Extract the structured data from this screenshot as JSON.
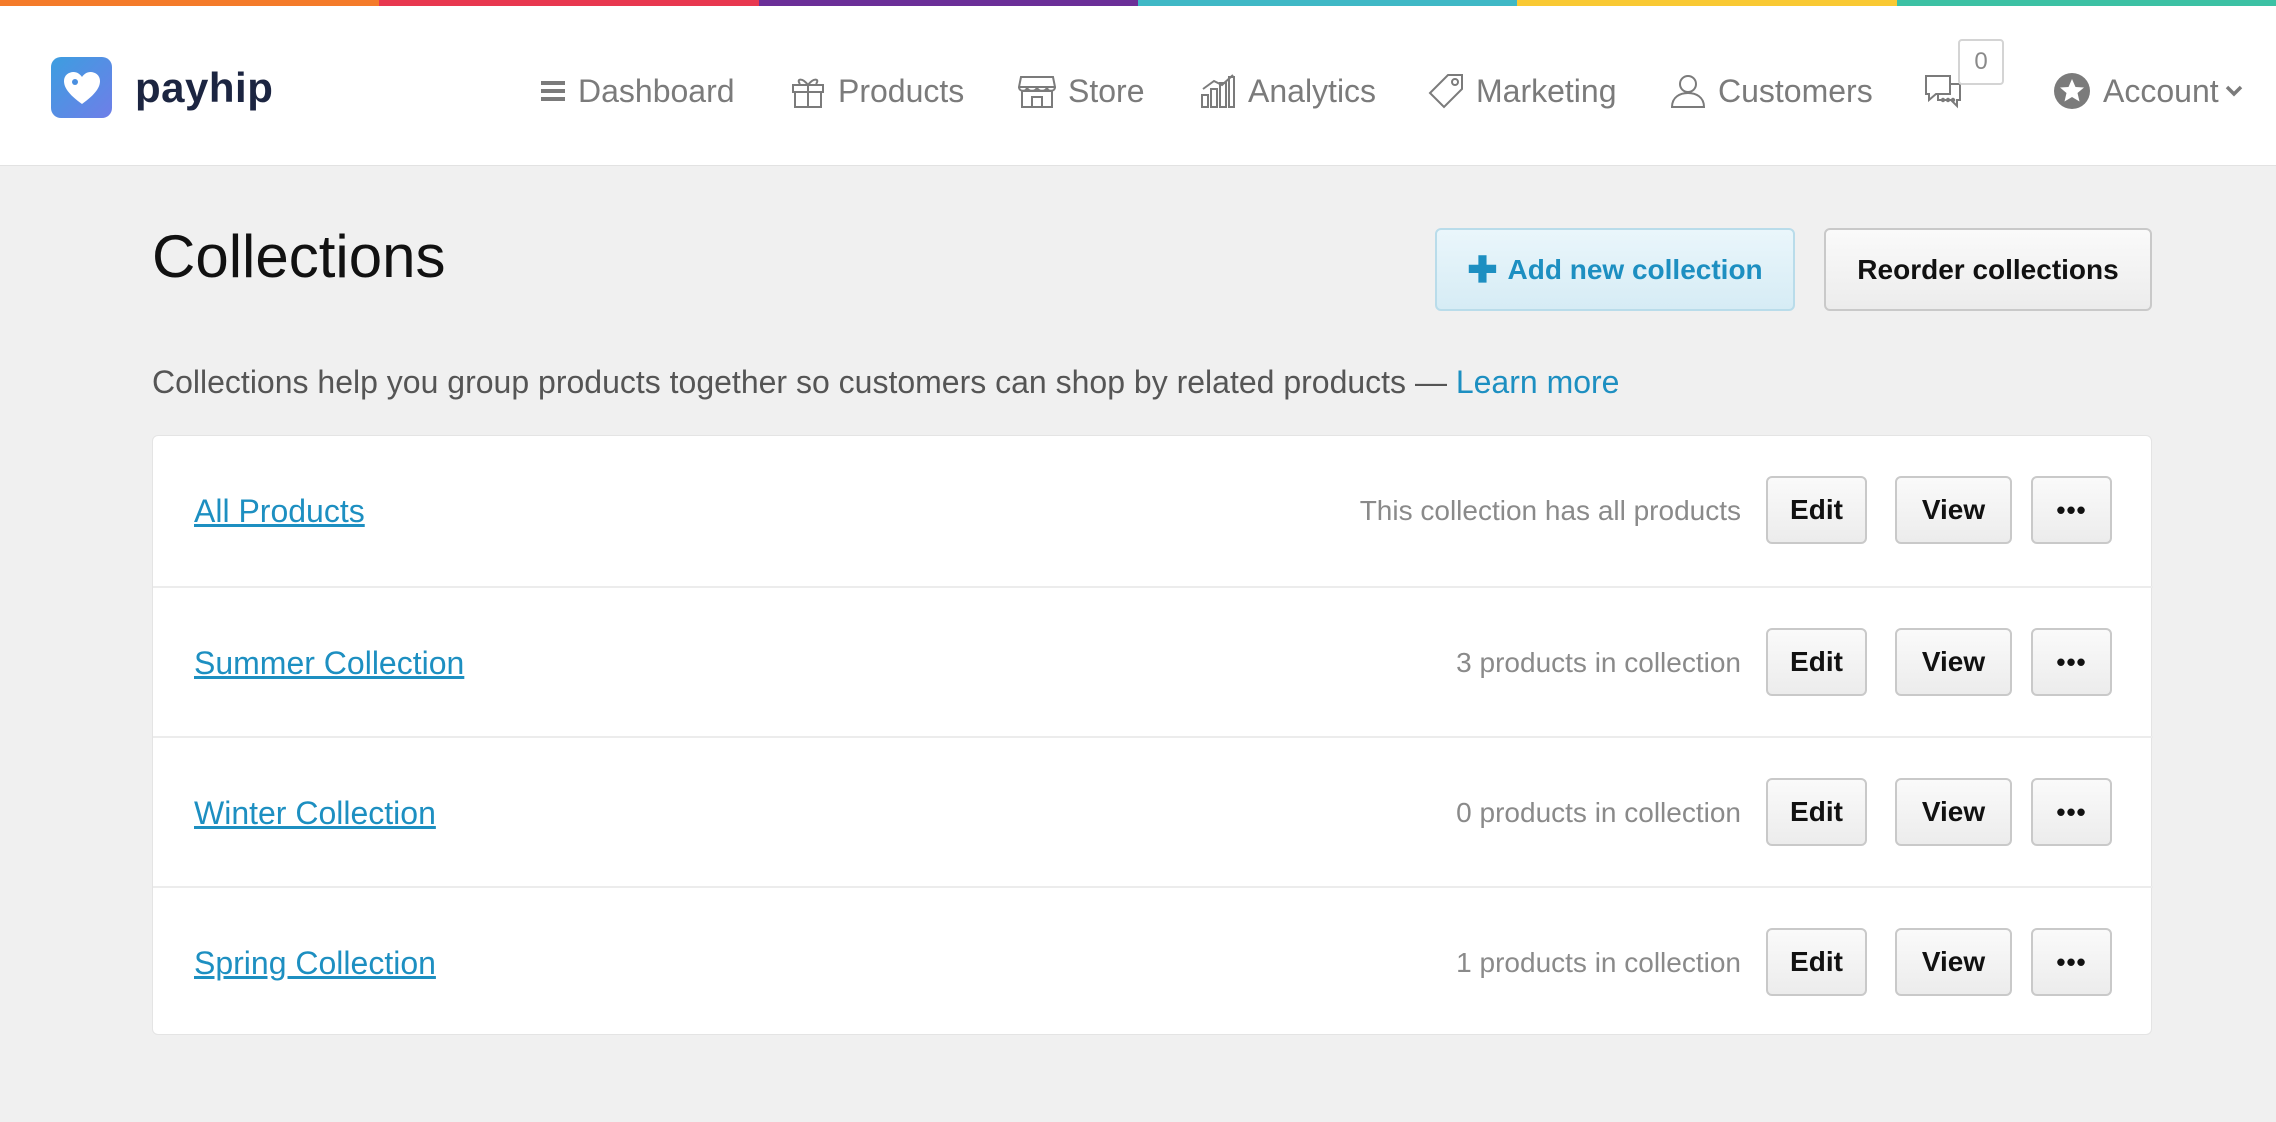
{
  "colors": {
    "rainbow": [
      "#f47b2a",
      "#e8384f",
      "#6b2f98",
      "#3fb8c6",
      "#f9c933",
      "#3cc1a4"
    ],
    "accent": "#1d8fc1",
    "brand_logo": "#3c9ee0"
  },
  "brand": {
    "name": "payhip",
    "icon": "heart-tag-icon"
  },
  "nav": {
    "dashboard": {
      "label": "Dashboard",
      "icon": "menu-icon"
    },
    "products": {
      "label": "Products",
      "icon": "gift-icon"
    },
    "store": {
      "label": "Store",
      "icon": "storefront-icon"
    },
    "analytics": {
      "label": "Analytics",
      "icon": "bar-chart-icon"
    },
    "marketing": {
      "label": "Marketing",
      "icon": "tag-icon"
    },
    "customers": {
      "label": "Customers",
      "icon": "user-icon"
    },
    "messages": {
      "icon": "chat-icon",
      "count": "0"
    },
    "account": {
      "label": "Account",
      "icon": "star-circle-icon"
    }
  },
  "page": {
    "title": "Collections",
    "add_button": "Add new collection",
    "reorder_button": "Reorder collections",
    "intro": "Collections help you group products together so customers can shop by related products —",
    "learn_more": "Learn more"
  },
  "collections": [
    {
      "name": "All Products",
      "info": "This collection has all products",
      "edit": "Edit",
      "view": "View",
      "more": "•••"
    },
    {
      "name": "Summer Collection",
      "info": "3 products in collection",
      "edit": "Edit",
      "view": "View",
      "more": "•••"
    },
    {
      "name": "Winter Collection",
      "info": "0 products in collection",
      "edit": "Edit",
      "view": "View",
      "more": "•••"
    },
    {
      "name": "Spring Collection",
      "info": "1 products in collection",
      "edit": "Edit",
      "view": "View",
      "more": "•••"
    }
  ]
}
